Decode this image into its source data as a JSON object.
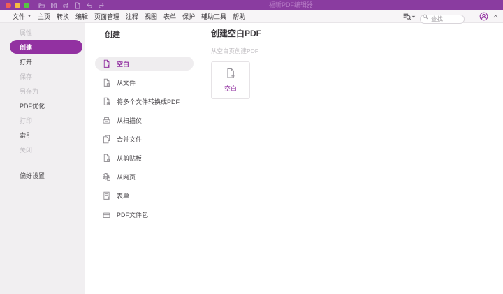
{
  "titlebar": {
    "title": "福昕PDF编辑器",
    "window_controls": [
      "close",
      "minimize",
      "zoom"
    ],
    "quick_access_icons": [
      "open-folder-icon",
      "save-icon",
      "print-icon",
      "new-document-icon",
      "undo-icon",
      "redo-icon"
    ]
  },
  "menubar": {
    "items": [
      "文件",
      "主页",
      "转换",
      "编辑",
      "页面管理",
      "注释",
      "视图",
      "表单",
      "保护",
      "辅助工具",
      "帮助"
    ],
    "search": {
      "placeholder": "查找"
    },
    "right_icons": [
      "find-replace-icon",
      "dropdown-caret-icon",
      "search-icon",
      "more-options-icon",
      "account-icon",
      "collapse-toolbar-icon"
    ]
  },
  "sidebar": {
    "items": [
      {
        "label": "属性",
        "enabled": false,
        "selected": false
      },
      {
        "label": "创建",
        "enabled": true,
        "selected": true
      },
      {
        "label": "打开",
        "enabled": true,
        "selected": false
      },
      {
        "label": "保存",
        "enabled": false,
        "selected": false
      },
      {
        "label": "另存为",
        "enabled": false,
        "selected": false
      },
      {
        "label": "PDF优化",
        "enabled": true,
        "selected": false
      },
      {
        "label": "打印",
        "enabled": false,
        "selected": false
      },
      {
        "label": "索引",
        "enabled": true,
        "selected": false
      },
      {
        "label": "关闭",
        "enabled": false,
        "selected": false
      }
    ],
    "footer_item": "偏好设置"
  },
  "create_list": {
    "title": "创建",
    "items": [
      {
        "label": "空白",
        "icon": "blank-document-icon",
        "selected": true
      },
      {
        "label": "从文件",
        "icon": "from-file-icon",
        "selected": false
      },
      {
        "label": "将多个文件转换成PDF",
        "icon": "convert-multiple-files-icon",
        "selected": false
      },
      {
        "label": "从扫描仪",
        "icon": "scanner-icon",
        "selected": false
      },
      {
        "label": "合并文件",
        "icon": "combine-files-icon",
        "selected": false
      },
      {
        "label": "从剪贴板",
        "icon": "clipboard-icon",
        "selected": false
      },
      {
        "label": "从网页",
        "icon": "web-page-icon",
        "selected": false
      },
      {
        "label": "表单",
        "icon": "form-icon",
        "selected": false
      },
      {
        "label": "PDF文件包",
        "icon": "pdf-portfolio-icon",
        "selected": false
      }
    ]
  },
  "main_panel": {
    "title": "创建空白PDF",
    "subtitle": "从空白页创建PDF",
    "card": {
      "label": "空白",
      "icon": "blank-document-icon"
    }
  },
  "colors": {
    "titlebar_purple": "#8a3ca0",
    "accent_purple": "#9231a1",
    "sidebar_background": "#f1eff1",
    "selected_row_background": "#efedef",
    "disabled_text": "#bfbcc1",
    "traffic_red": "#f15f56",
    "traffic_yellow": "#f5bd41",
    "traffic_green": "#57c343"
  }
}
